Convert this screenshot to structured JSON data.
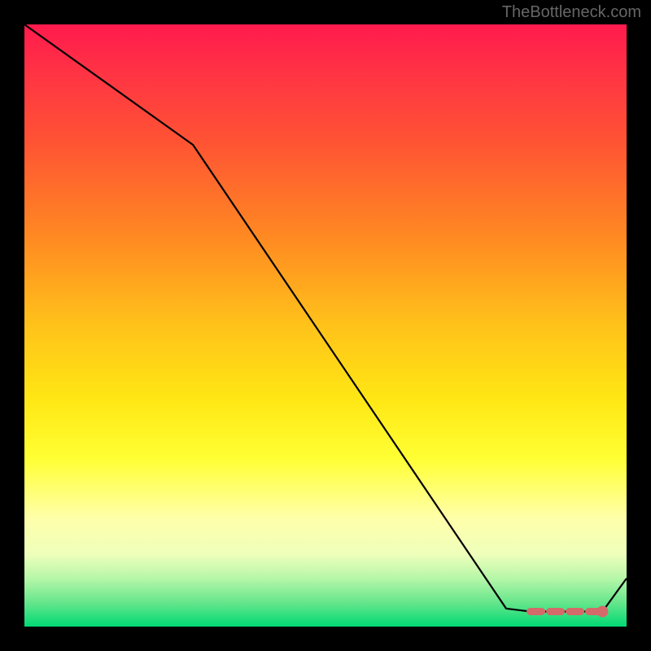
{
  "watermark": "TheBottleneck.com",
  "chart_data": {
    "type": "line",
    "title": "",
    "xlabel": "",
    "ylabel": "",
    "xlim": [
      0,
      100
    ],
    "ylim": [
      0,
      100
    ],
    "series": [
      {
        "name": "curve",
        "x": [
          0,
          28,
          80,
          84,
          96,
          100
        ],
        "values": [
          100,
          80,
          3,
          2.5,
          2.5,
          8
        ]
      }
    ],
    "markers": [
      {
        "name": "dashed-segment",
        "x": [
          84,
          96
        ],
        "y": [
          2.5,
          2.5
        ],
        "style": "dashed",
        "color": "#d46a6a"
      },
      {
        "name": "end-dot",
        "x": 96,
        "y": 2.5,
        "color": "#d46a6a",
        "r": 5
      }
    ],
    "background_gradient": {
      "top": "#ff1a4d",
      "mid_upper": "#ff8822",
      "mid": "#ffe614",
      "mid_lower": "#ffffaa",
      "bottom": "#00d973"
    }
  }
}
